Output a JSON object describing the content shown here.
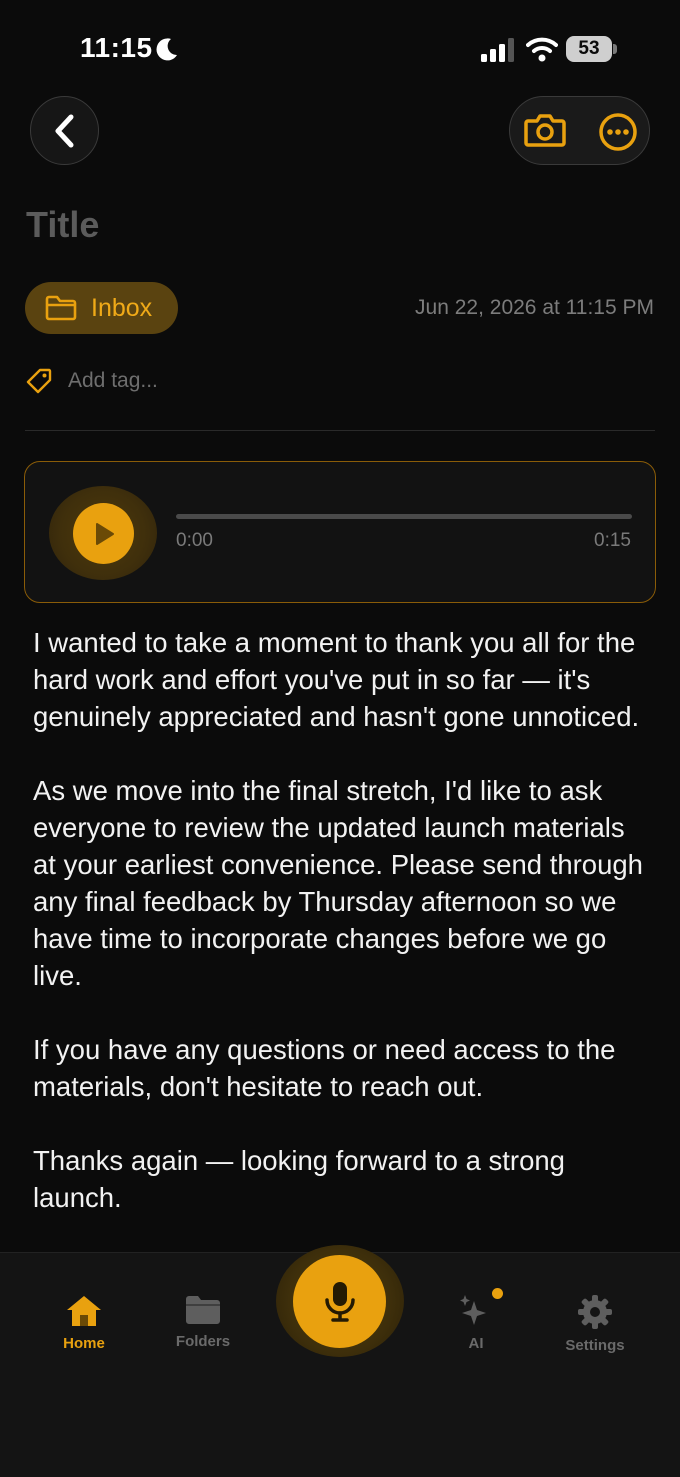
{
  "status_bar": {
    "time": "11:15",
    "battery": "53"
  },
  "header": {
    "title_placeholder": "Title"
  },
  "meta": {
    "folder": "Inbox",
    "date": "Jun 22, 2026 at 11:15 PM",
    "tag_placeholder": "Add tag..."
  },
  "audio": {
    "current_time": "0:00",
    "total_time": "0:15",
    "progress": 0
  },
  "note": {
    "paragraphs": [
      "I wanted to take a moment to thank you all for the hard work and effort you've put in so far — it's genuinely appreciated and hasn't gone unnoticed.",
      "As we move into the final stretch, I'd like to ask everyone to review the updated launch materials at your earliest convenience. Please send through any final feedback by Thursday afternoon so we have time to incorporate changes before we go live.",
      "If you have any questions or need access to the materials, don't hesitate to reach out.",
      "Thanks again — looking forward to a strong launch."
    ]
  },
  "tabs": [
    {
      "label": "Home",
      "icon": "home-icon",
      "active": true
    },
    {
      "label": "Folders",
      "icon": "folder-icon",
      "active": false
    },
    {
      "label": "AI",
      "icon": "sparkles-icon",
      "active": false
    },
    {
      "label": "Settings",
      "icon": "gear-icon",
      "active": false
    }
  ],
  "colors": {
    "accent": "#e9a10f",
    "background": "#0b0b0b",
    "chip_bg": "#5a4310"
  }
}
